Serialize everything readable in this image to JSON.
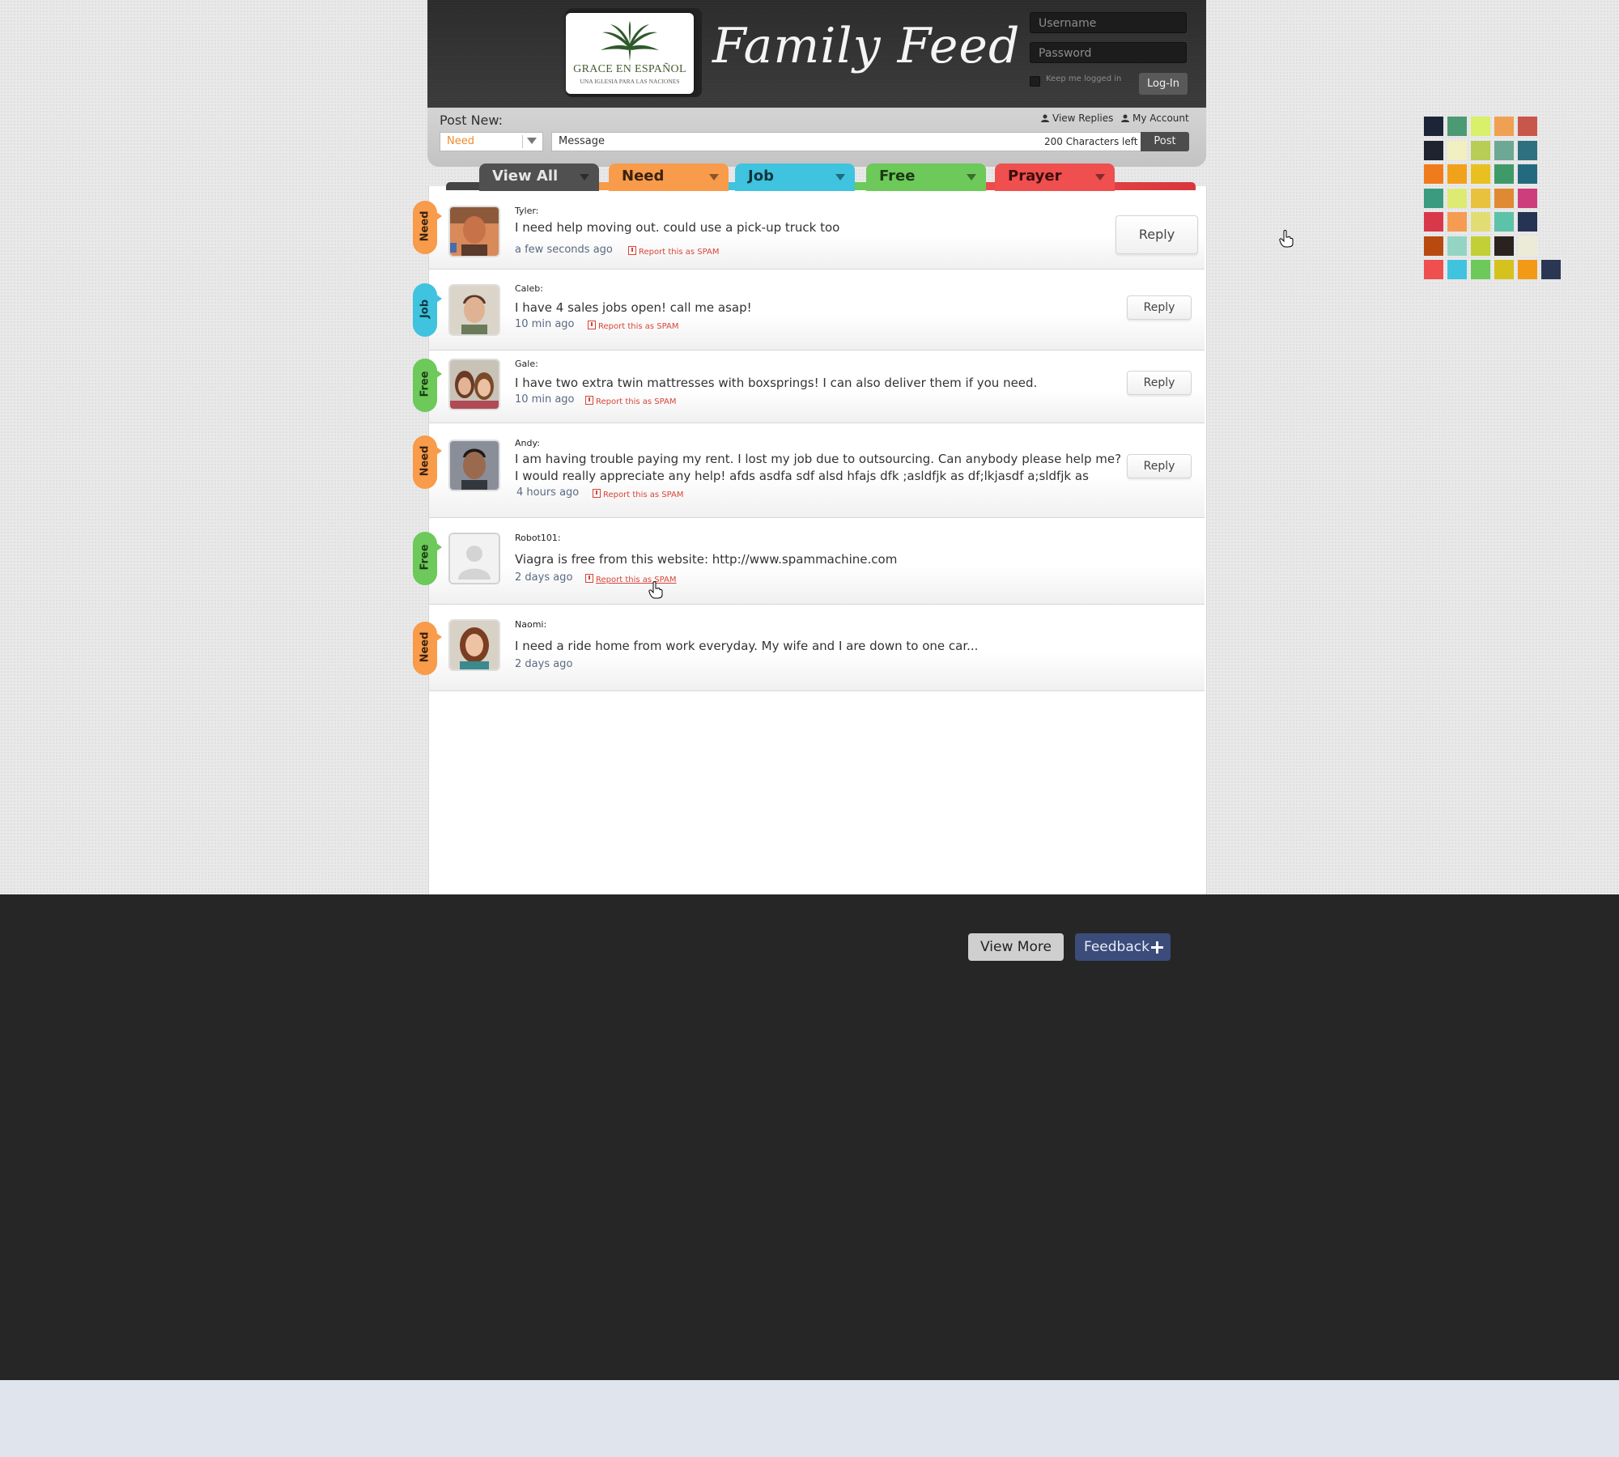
{
  "header": {
    "logo_name": "GRACE EN ESPAÑOL",
    "logo_tagline": "UNA IGLESIA PARA LAS NACIONES",
    "title": "Family Feed",
    "username_placeholder": "Username",
    "password_placeholder": "Password",
    "keep_logged_in": "Keep me logged in",
    "login_label": "Log-In"
  },
  "post_bar": {
    "label": "Post New:",
    "view_replies": "View Replies",
    "my_account": "My Account",
    "category_selected": "Need",
    "message_placeholder": "Message",
    "chars_left": "200 Characters left",
    "post_label": "Post"
  },
  "tabs": [
    {
      "label": "View All",
      "color": "#505050",
      "text_color": "#e6e6e6"
    },
    {
      "label": "Need",
      "color": "#f89b4a",
      "text_color": "#3a2210"
    },
    {
      "label": "Job",
      "color": "#3fc3de",
      "text_color": "#10353f"
    },
    {
      "label": "Free",
      "color": "#6cc95a",
      "text_color": "#1b3a14"
    },
    {
      "label": "Prayer",
      "color": "#ef4f4f",
      "text_color": "#3d0e0e"
    }
  ],
  "feed": [
    {
      "category": "Need",
      "author": "Tyler:",
      "message": "I need help moving out. could use a pick-up truck too",
      "time": "a few seconds ago",
      "spam": "Report this as SPAM",
      "reply": "Reply"
    },
    {
      "category": "Job",
      "author": "Caleb:",
      "message": "I have 4 sales jobs open!  call me asap!",
      "time": "10 min ago",
      "spam": "Report this as SPAM",
      "reply": "Reply"
    },
    {
      "category": "Free",
      "author": "Gale:",
      "message": "I have two extra twin mattresses with boxsprings!  I can also deliver them if you need.",
      "time": "10 min ago",
      "spam": "Report this as SPAM",
      "reply": "Reply"
    },
    {
      "category": "Need",
      "author": "Andy:",
      "message_line1": "I am having trouble paying my rent. I lost my job due to outsourcing. Can anybody please help me?",
      "message_line2": "I would really appreciate any help! afds asdfa sdf alsd hfajs dfk  ;asldfjk as df;lkjasdf  a;sldfjk as",
      "time": "4 hours ago",
      "spam": "Report this as SPAM",
      "reply": "Reply"
    },
    {
      "category": "Free",
      "author": "Robot101:",
      "message": "Viagra is free from this website:  http://www.spammachine.com",
      "time": "2 days ago",
      "spam": "Report this as SPAM"
    },
    {
      "category": "Need",
      "author": "Naomi:",
      "message": "I need a ride home from work everyday.  My wife and I are down to one car...",
      "time": "2 days ago"
    }
  ],
  "footer": {
    "view_more": "View More",
    "feedback": "Feedback"
  },
  "category_colors": {
    "Need": "#f89b4a",
    "Job": "#3fc3de",
    "Free": "#6cc95a",
    "Prayer": "#ef4f4f"
  },
  "palette": [
    [
      "#1c2437",
      "#4c9a74",
      "#d8f06a",
      "#f0a052",
      "#c8574b"
    ],
    [
      "#1f2330",
      "#f2efc0",
      "#b8cd55",
      "#6da894",
      "#2e6f80"
    ],
    [
      "#f07b1c",
      "#f1a11b",
      "#e8c120",
      "#3f9a6a",
      "#246a7e"
    ],
    [
      "#3a9b7e",
      "#ddeb73",
      "#e8c13d",
      "#df8a33",
      "#cc3f7c"
    ],
    [
      "#d9384a",
      "#f59c52",
      "#e2dd73",
      "#5cc2a8",
      "#263352"
    ],
    [
      "#b84a10",
      "#94d4c2",
      "#c2cf36",
      "#2a221e",
      "#ecebd8"
    ],
    [
      "#ef4f4f",
      "#3fc3de",
      "#6cc95a",
      "#d6c21f",
      "#f29a15",
      "#2b3653"
    ]
  ]
}
